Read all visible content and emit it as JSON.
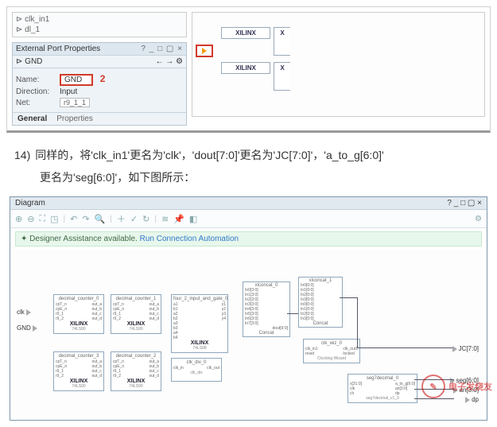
{
  "top": {
    "signals": [
      "clk_in1",
      "dl_1"
    ],
    "prop_panel_title": "External Port Properties",
    "win_ctrls": "? _ □ ▢ ×",
    "port_name_icon_label": "GND",
    "nav_arrows": "← → ⚙",
    "rows": {
      "name_label": "Name:",
      "name_value": "GND",
      "name_badge": "2",
      "dir_label": "Direction:",
      "dir_value": "Input",
      "net_label": "Net:",
      "net_value": "r9_1_1"
    },
    "tabs": {
      "general": "General",
      "properties": "Properties"
    },
    "xilinx": "XILINX"
  },
  "step": {
    "no": "14)",
    "line1a": "同样的，将'",
    "sig1": "clk_in1",
    "line1b": "'更名为'",
    "ren1": "clk",
    "line1c": "'，'",
    "sig2": "dout[7:0]",
    "line1d": "'更名为'",
    "ren2": "JC[7:0]",
    "line1e": "'，'",
    "sig3": "a_to_g[6:0]",
    "line1f": "'",
    "line2a": "更名为'",
    "ren3": "seg[6:0]",
    "line2b": "'，如下图所示："
  },
  "diagram": {
    "title": "Diagram",
    "win_ctrls": "? _ □ ▢ ×",
    "assist_text": "Designer Assistance available.",
    "assist_link": "Run Connection Automation",
    "gear": "⚙",
    "ports": {
      "clk": "clk",
      "gnd": "GND",
      "jc": "JC[7:0]",
      "seg": "seg[6:0]",
      "an": "an[3:0]",
      "dp": "dp"
    },
    "blocks": {
      "dc0": "decimal_counter_0",
      "dc1": "decimal_counter_1",
      "dc2": "decimal_counter_2",
      "dc3": "decimal_counter_3",
      "and": "four_2_input_and_gate_0",
      "clkdiv": "clk_div_0",
      "clkdiv_sub": "clk_div",
      "clkwiz": "Clocking Wizard",
      "clkwiz_lbl": "clk_wiz_0",
      "concat0": "xlconcat_0",
      "concat1": "xlconcat_1",
      "concat": "Concat",
      "seg7": "seg7decimal_0",
      "seg7ftr": "seg7decimal_v1_0",
      "xil": "XILINX",
      "ftr": "74LS90",
      "dout": "dout[9:0]",
      "p_in0": "In0[3:0]",
      "p_in1": "In1[3:0]",
      "p_in2": "In2[3:0]",
      "p_in3": "In3[3:0]",
      "p_in4": "In4[3:0]",
      "p_in5": "In5[3:0]",
      "p_in6": "In6[3:0]",
      "p_in7": "In7[3:0]",
      "p_scin0": "In0[0:0]",
      "p_scin1": "In1[0:0]",
      "p_scin2": "In2[0:0]",
      "p_scin3": "In3[0:0]",
      "clk_out1": "clk_out1",
      "clk_in1": "clk_in1",
      "seg_in_x": "x[31:0]",
      "seg_clk": "clk",
      "seg_clr": "clr",
      "seg_atog": "a_to_g[6:0]",
      "seg_an": "an[3:0]",
      "seg_dp": "dp"
    }
  },
  "watermark": "电子发烧友"
}
